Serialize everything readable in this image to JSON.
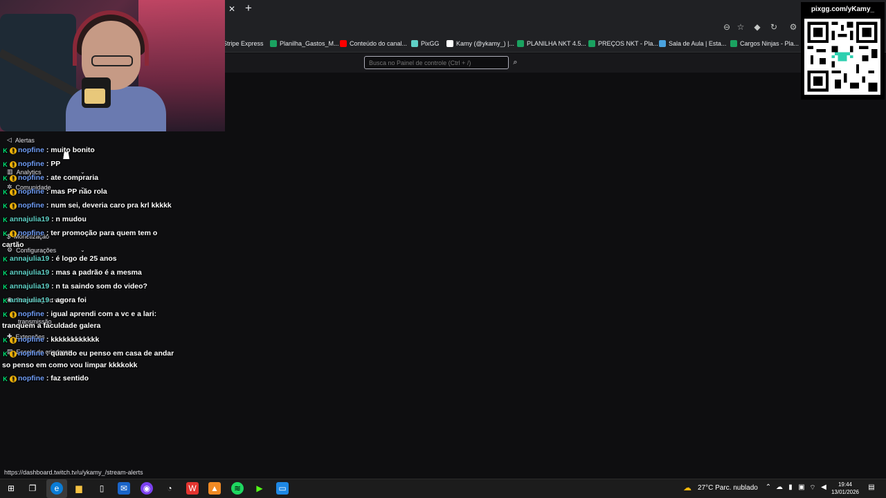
{
  "browser": {
    "bookmarks": [
      {
        "label": "Stripe Express",
        "color": "#635bff"
      },
      {
        "label": "Planilha_Gastos_M...",
        "color": "#1aa260"
      },
      {
        "label": "Conteúdo do canal...",
        "color": "#ff0000"
      },
      {
        "label": "PixGG",
        "color": "#5fd0c6"
      },
      {
        "label": "Kamy (@ykamy_) |...",
        "color": "#ffffff"
      },
      {
        "label": "PLANILHA NKT 4.5...",
        "color": "#1aa260"
      },
      {
        "label": "PREÇOS NKT - Pla...",
        "color": "#1aa260"
      },
      {
        "label": "Sala de Aula | Esta...",
        "color": "#4aa3df"
      },
      {
        "label": "Cargos Ninjas - Pla...",
        "color": "#1aa260"
      }
    ],
    "status_url": "https://dashboard.twitch.tv/u/ykamy_/stream-alerts"
  },
  "dashboard": {
    "search_placeholder": "Busca no Painel de controle (Ctrl + /)",
    "sidebar": [
      {
        "label": "Alertas",
        "icon": "megaphone-icon"
      },
      {
        "label": "Analytics",
        "icon": "chart-icon"
      },
      {
        "label": "Comunidade",
        "icon": "community-icon"
      },
      {
        "label": "Monetização",
        "icon": "money-icon"
      },
      {
        "label": "Configurações",
        "icon": "gear-icon"
      },
      {
        "label": "Streaming ao vivo",
        "icon": "broadcast-icon"
      },
      {
        "label": "transmissão",
        "icon": "broadcast-icon"
      },
      {
        "label": "Extensões",
        "icon": "puzzle-icon"
      },
      {
        "label": "Escola de criadores",
        "icon": "school-icon"
      }
    ]
  },
  "overlay": {
    "qr_url": "pixgg.com/yKamy_"
  },
  "chat": [
    {
      "user": "nopfine",
      "msg": ": muito bonito",
      "sub": true
    },
    {
      "user": "nopfine",
      "msg": ": PP",
      "sub": true
    },
    {
      "user": "nopfine",
      "msg": ": ate compraria",
      "sub": true
    },
    {
      "user": "nopfine",
      "msg": ": mas PP não rola",
      "sub": true
    },
    {
      "user": "nopfine",
      "msg": ": num sei, deveria caro pra krl kkkkk",
      "sub": true
    },
    {
      "user": "annajulia19",
      "msg": ": n mudou",
      "sub": false
    },
    {
      "user": "nopfine",
      "msg": ": ter promoção para quem tem o cartão",
      "sub": true
    },
    {
      "user": "annajulia19",
      "msg": ": é logo de 25 anos",
      "sub": false
    },
    {
      "user": "annajulia19",
      "msg": ": mas a padrão é a mesma",
      "sub": false
    },
    {
      "user": "annajulia19",
      "msg": ": n ta saindo som do video?",
      "sub": false
    },
    {
      "user": "annajulia19",
      "msg": ": agora foi",
      "sub": false
    },
    {
      "user": "nopfine",
      "msg": ": igual aprendi com a vc e a lari: tranquem a faculdade galera",
      "sub": true
    },
    {
      "user": "nopfine",
      "msg": ": kkkkkkkkkkkk",
      "sub": true
    },
    {
      "user": "nopfine",
      "msg": ": quando eu penso em casa de andar so penso em como vou limpar kkkkokk",
      "sub": true
    },
    {
      "user": "nopfine",
      "msg": ": faz sentido",
      "sub": true
    }
  ],
  "taskbar": {
    "weather": "27°C  Parc. nublado",
    "time": "19:44",
    "date": "13/01/2026"
  }
}
